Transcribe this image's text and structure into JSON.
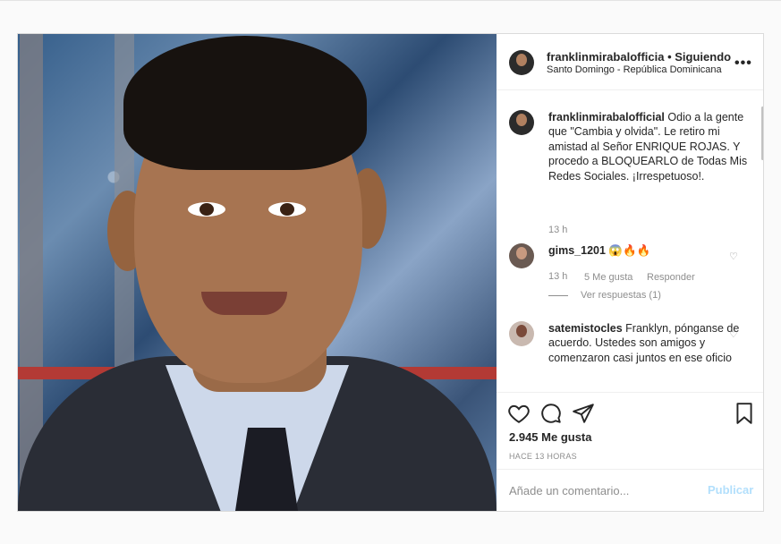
{
  "post": {
    "username": "franklinmirabalofficia",
    "separator": " • ",
    "follow_status": "Siguiendo",
    "location": "Santo Domingo - República Dominicana",
    "more_icon": "more-horizontal-icon",
    "caption": {
      "username": "franklinmirabalofficial",
      "text": "Odio a la gente que \"Cambia y olvida\". Le retiro mi amistad al Señor ENRIQUE ROJAS. Y procedo a BLOQUEARLO de Todas Mis Redes Sociales. ¡Irrespetuoso!.",
      "time": "13 h"
    },
    "comments": [
      {
        "username": "gims_1201",
        "text": "😱🔥🔥",
        "time": "13 h",
        "likes": "5 Me gusta",
        "reply": "Responder",
        "view_replies": "Ver respuestas (1)"
      },
      {
        "username": "satemistocles",
        "text": "Franklyn, pónganse de acuerdo. Ustedes son amigos y comenzaron casi juntos en ese oficio"
      }
    ],
    "likes_count": "2.945 Me gusta",
    "posted_ago": "HACE 13 HORAS",
    "comment_placeholder": "Añade un comentario...",
    "publish_label": "Publicar"
  }
}
